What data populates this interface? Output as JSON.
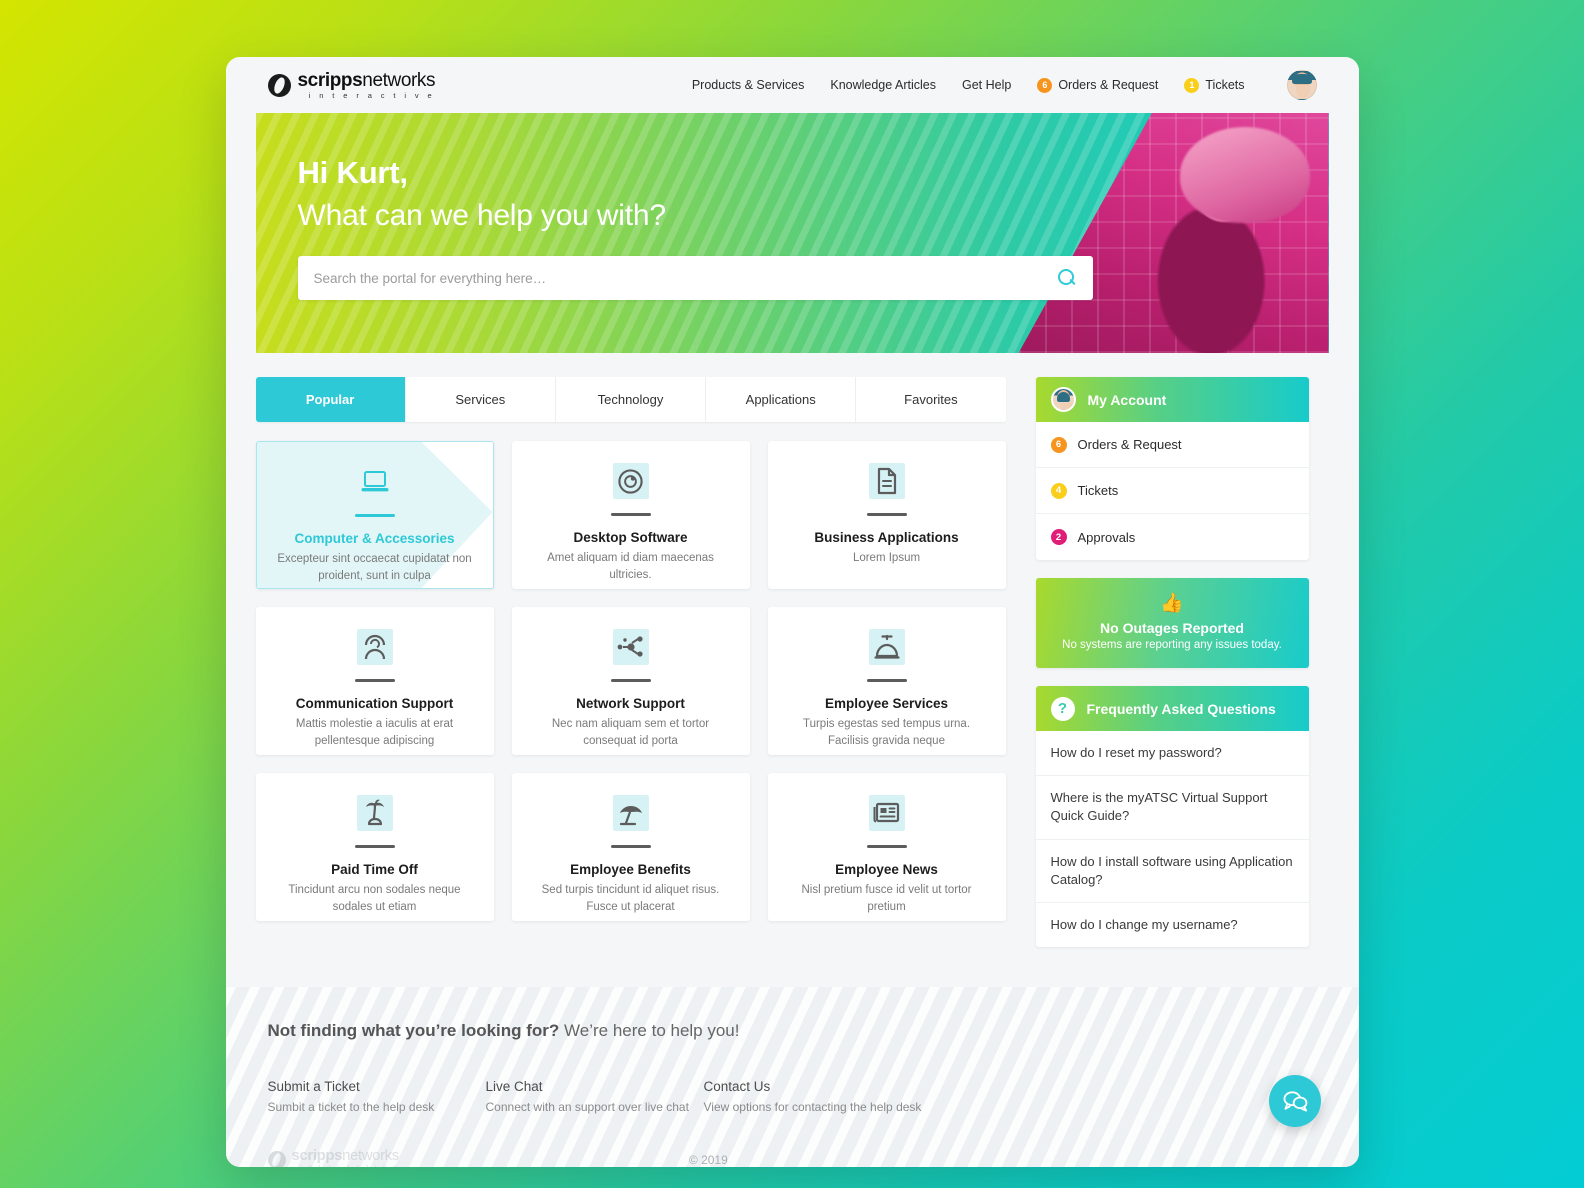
{
  "brand": {
    "name_bold": "scripps",
    "name_light": "networks",
    "tagline": "i n t e r a c t i v e"
  },
  "header": {
    "nav": [
      {
        "label": "Products & Services",
        "badge": null,
        "badge_color": null
      },
      {
        "label": "Knowledge Articles",
        "badge": null,
        "badge_color": null
      },
      {
        "label": "Get Help",
        "badge": null,
        "badge_color": null
      },
      {
        "label": "Orders & Request",
        "badge": "6",
        "badge_color": "#f7941e"
      },
      {
        "label": "Tickets",
        "badge": "1",
        "badge_color": "#f9cf1c"
      }
    ],
    "avatar_name": "user-avatar"
  },
  "hero": {
    "greeting": "Hi Kurt,",
    "question": "What can we help you with?",
    "search_placeholder": "Search the portal for everything here…",
    "search_value": ""
  },
  "tabs": [
    {
      "label": "Popular",
      "active": true
    },
    {
      "label": "Services",
      "active": false
    },
    {
      "label": "Technology",
      "active": false
    },
    {
      "label": "Applications",
      "active": false
    },
    {
      "label": "Favorites",
      "active": false
    }
  ],
  "cards": [
    {
      "title": "Computer & Accessories",
      "desc": "Excepteur sint occaecat cupidatat non proident, sunt in culpa",
      "icon": "laptop-icon",
      "highlighted": true
    },
    {
      "title": "Desktop Software",
      "desc": "Amet aliquam id diam maecenas ultricies.",
      "icon": "disc-icon",
      "highlighted": false
    },
    {
      "title": "Business Applications",
      "desc": "Lorem Ipsum",
      "icon": "document-icon",
      "highlighted": false
    },
    {
      "title": "Communication Support",
      "desc": "Mattis molestie a iaculis at erat pellentesque adipiscing",
      "icon": "headset-icon",
      "highlighted": false
    },
    {
      "title": "Network Support",
      "desc": "Nec nam aliquam sem et tortor consequat id porta",
      "icon": "network-icon",
      "highlighted": false
    },
    {
      "title": "Employee Services",
      "desc": "Turpis egestas sed tempus urna. Facilisis gravida neque",
      "icon": "service-bell-icon",
      "highlighted": false
    },
    {
      "title": "Paid Time Off",
      "desc": "Tincidunt arcu non sodales neque sodales ut etiam",
      "icon": "palm-tree-icon",
      "highlighted": false
    },
    {
      "title": "Employee Benefits",
      "desc": "Sed turpis tincidunt id aliquet risus. Fusce ut placerat",
      "icon": "beach-umbrella-icon",
      "highlighted": false
    },
    {
      "title": "Employee News",
      "desc": "Nisl pretium fusce id velit ut tortor pretium",
      "icon": "newspaper-icon",
      "highlighted": false
    }
  ],
  "account": {
    "title": "My Account",
    "rows": [
      {
        "label": "Orders & Request",
        "badge": "6",
        "badge_color": "#f7941e"
      },
      {
        "label": "Tickets",
        "badge": "4",
        "badge_color": "#f9cf1c"
      },
      {
        "label": "Approvals",
        "badge": "2",
        "badge_color": "#e01e79"
      }
    ]
  },
  "outage": {
    "icon": "thumbs-up-icon",
    "title": "No Outages Reported",
    "subtitle": "No systems are reporting any issues today."
  },
  "faq": {
    "title": "Frequently Asked Questions",
    "badge": "?",
    "items": [
      "How do I reset my password?",
      "Where is the myATSC Virtual Support Quick Guide?",
      "How do I install software using Application Catalog?",
      "How do I change my username?"
    ]
  },
  "footer": {
    "head_bold": "Not finding what you’re looking for?",
    "head_rest": " We’re here to help you!",
    "cols": [
      {
        "title": "Submit a Ticket",
        "desc": "Sumbit a ticket to the help desk"
      },
      {
        "title": "Live Chat",
        "desc": "Connect with an support over live chat"
      },
      {
        "title": "Contact Us",
        "desc": "View options for contacting the help desk"
      }
    ],
    "copyright": "© 2019"
  },
  "chat_fab": {
    "name": "live-chat-button"
  },
  "colors": {
    "accent_teal": "#2ec9d6",
    "orange": "#f7941e",
    "yellow": "#f9cf1c",
    "magenta": "#e01e79",
    "icon_gray": "#5c5c5c",
    "icon_bg": "#d6f2f5"
  }
}
